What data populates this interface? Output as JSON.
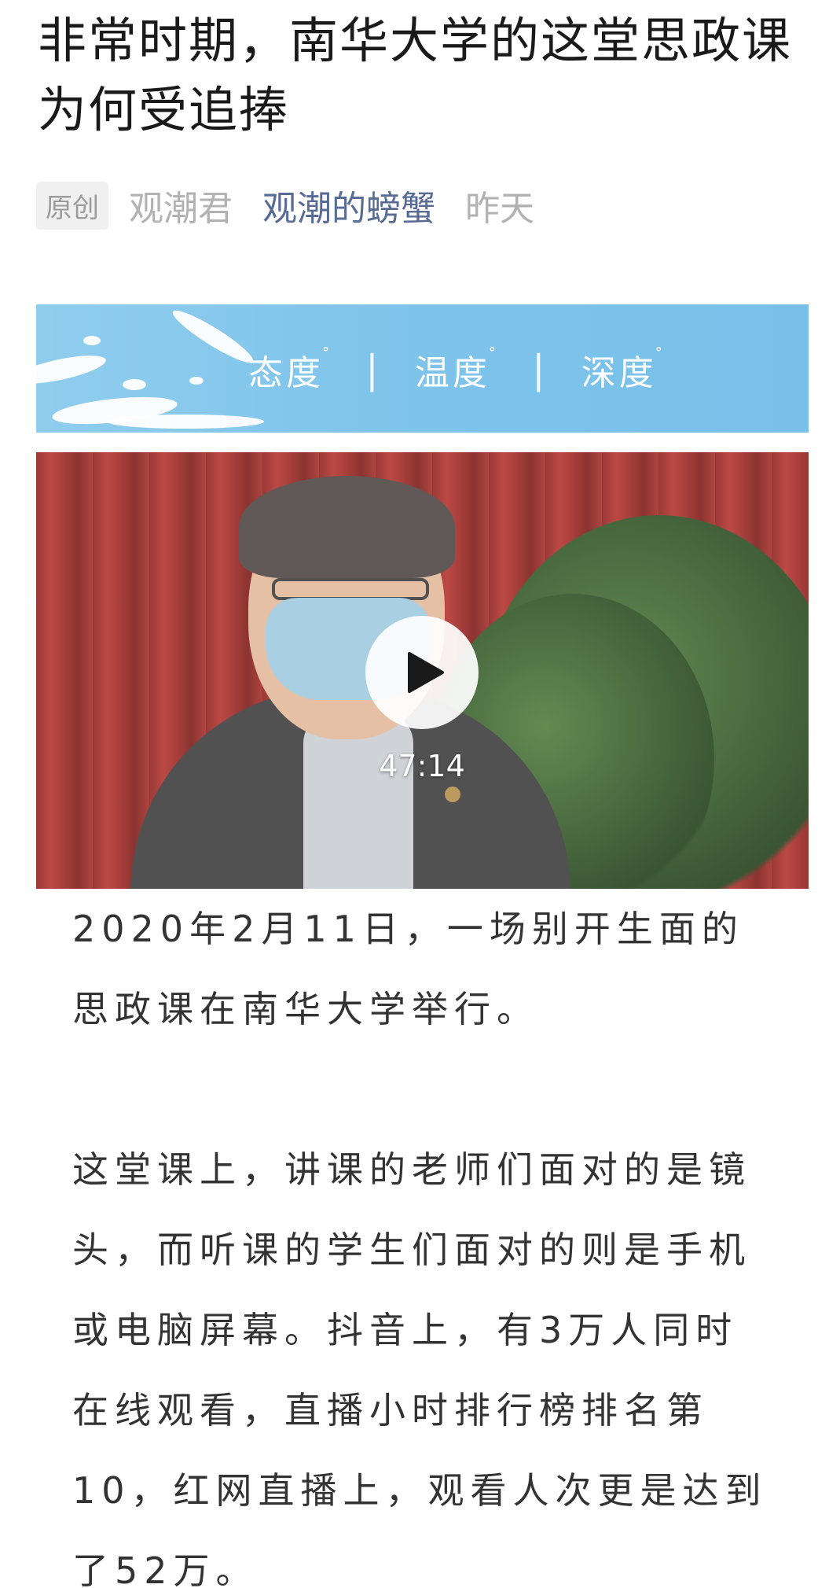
{
  "article": {
    "title": "非常时期，南华大学的这堂思政课为何受追捧",
    "meta": {
      "tag": "原创",
      "author": "观潮君",
      "account": "观潮的螃蟹",
      "time": "昨天"
    },
    "banner": {
      "items": [
        "态度",
        "温度",
        "深度"
      ],
      "degree_mark": "°",
      "separator": "|"
    },
    "video": {
      "duration": "47:14"
    },
    "paragraphs": [
      "2020年2月11日，一场别开生面的思政课在南华大学举行。",
      "这堂课上，讲课的老师们面对的是镜头，而听课的学生们面对的则是手机或电脑屏幕。抖音上，有3万人同时在线观看，直播小时排行榜排名第10，红网直播上，观看人次更是达到了52万。"
    ]
  },
  "colors": {
    "link": "#576b95",
    "meta_gray": "#b2b2b2",
    "banner_blue": "#7ec3ea",
    "body_text": "#333333"
  }
}
